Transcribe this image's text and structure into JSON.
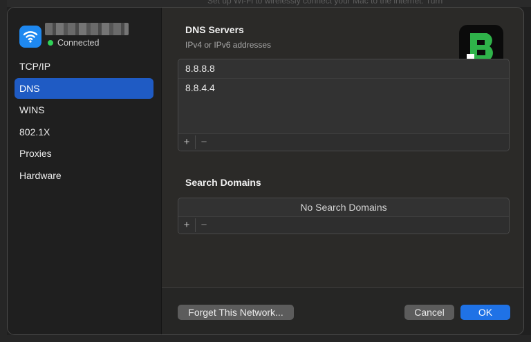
{
  "background": {
    "hint_text": "Set up Wi-Fi to wirelessly connect your Mac to the internet. Turn"
  },
  "network": {
    "status": "Connected",
    "status_color": "#30d158",
    "icon": "wifi-icon"
  },
  "sidebar": {
    "items": [
      {
        "label": "TCP/IP",
        "active": false
      },
      {
        "label": "DNS",
        "active": true
      },
      {
        "label": "WINS",
        "active": false
      },
      {
        "label": "802.1X",
        "active": false
      },
      {
        "label": "Proxies",
        "active": false
      },
      {
        "label": "Hardware",
        "active": false
      }
    ]
  },
  "dns": {
    "title": "DNS Servers",
    "subtitle": "IPv4 or IPv6 addresses",
    "servers": [
      "8.8.8.8",
      "8.8.4.4"
    ],
    "add_label": "+",
    "remove_label": "−"
  },
  "search_domains": {
    "title": "Search Domains",
    "empty_text": "No Search Domains",
    "add_label": "+",
    "remove_label": "−"
  },
  "buttons": {
    "forget": "Forget This Network...",
    "cancel": "Cancel",
    "ok": "OK"
  },
  "colors": {
    "accent": "#1f5bc4",
    "ok_button": "#1f72e6",
    "badge_green": "#2fb34a"
  }
}
